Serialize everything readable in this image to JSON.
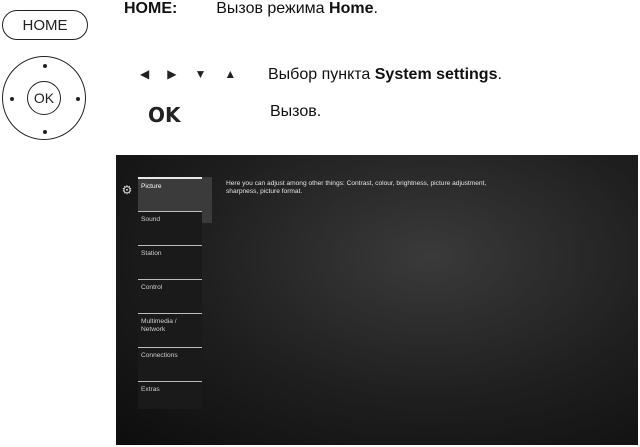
{
  "remote": {
    "home_key": "HOME",
    "ok_button": "OK"
  },
  "instructions": [
    {
      "key": "HOME:",
      "text": "Вызов режима ",
      "bold": "Home",
      "end": "."
    },
    {
      "text": "Выбор пункта ",
      "bold": "System settings",
      "end": "."
    },
    {
      "text": "Вызов."
    }
  ],
  "ok_label": "OK",
  "arrow_icons": [
    "left-arrow-icon",
    "right-arrow-icon",
    "down-arrow-icon",
    "up-arrow-icon"
  ],
  "tv": {
    "menu_items": [
      {
        "label": "Picture",
        "selected": true
      },
      {
        "label": "Sound",
        "selected": false
      },
      {
        "label": "Station",
        "selected": false
      },
      {
        "label": "Control",
        "selected": false
      },
      {
        "label": "Multimedia / Network",
        "selected": false
      },
      {
        "label": "Connections",
        "selected": false
      },
      {
        "label": "Extras",
        "selected": false
      }
    ],
    "description": "Here you can adjust among other things: Contrast, colour, brightness, picture adjustment, sharpness, picture format."
  }
}
